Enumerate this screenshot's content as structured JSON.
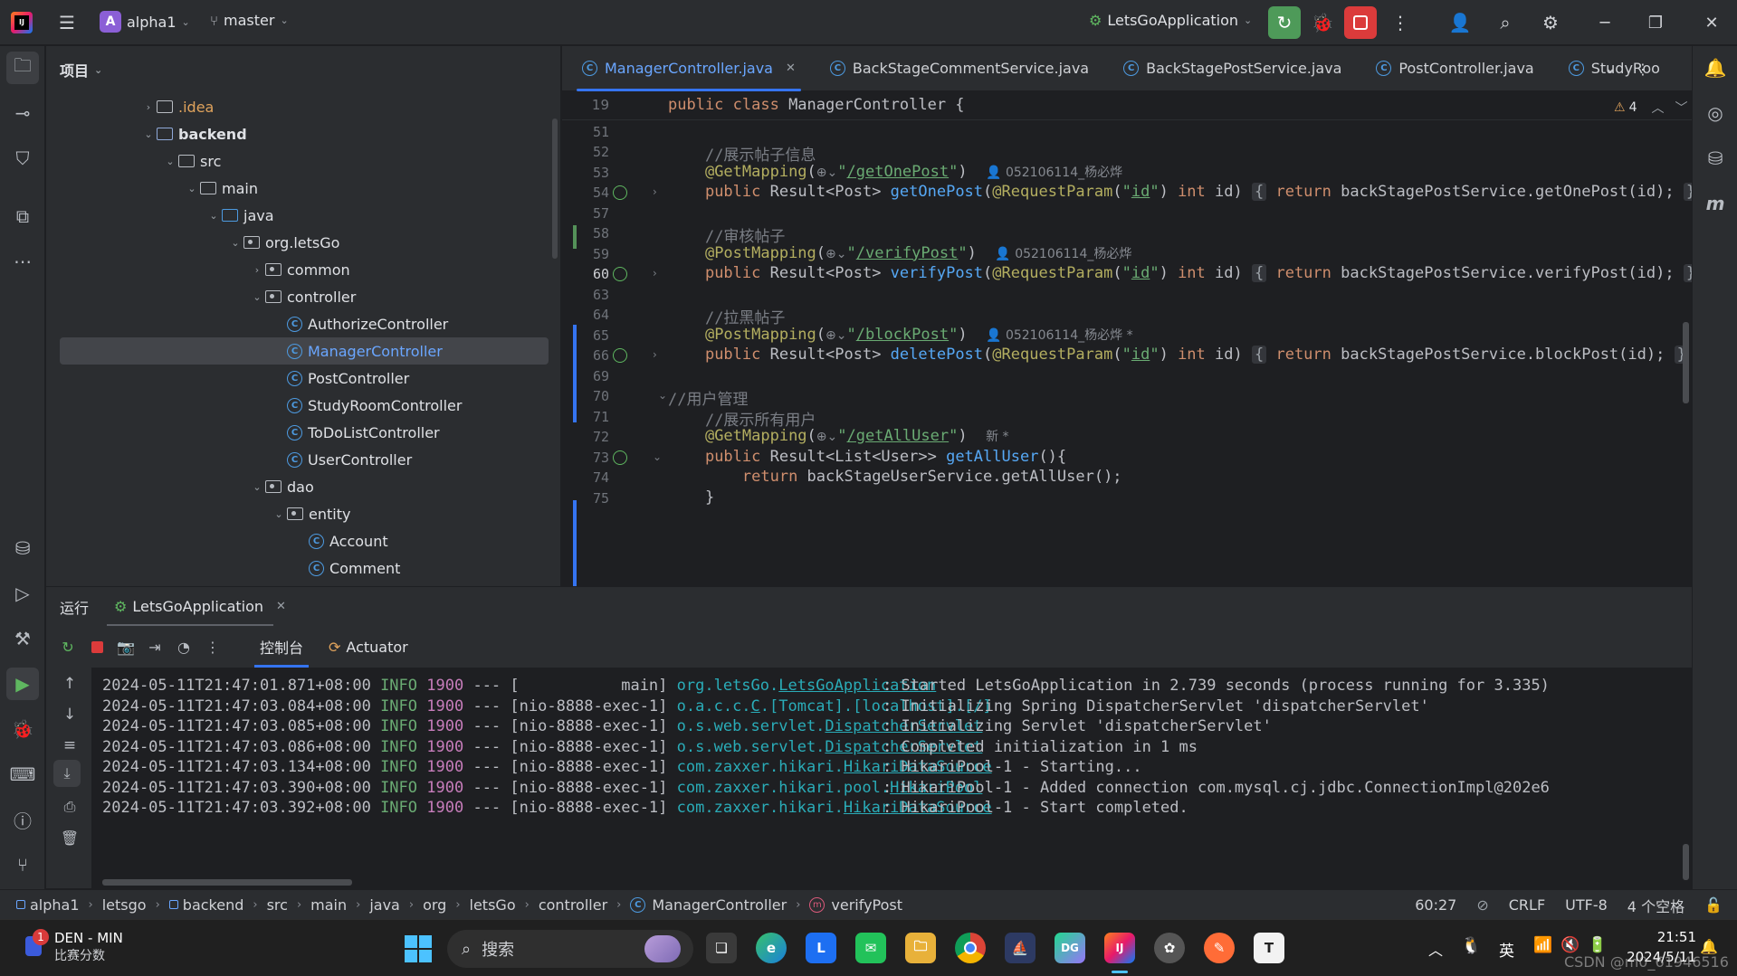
{
  "titlebar": {
    "project_letter": "A",
    "project_name": "alpha1",
    "branch": "master",
    "run_config": "LetsGoApplication"
  },
  "project_panel": {
    "title": "项目",
    "tree": [
      {
        "label": ".idea",
        "kind": "folder",
        "level": 2,
        "arrow": "›",
        "color": "orange"
      },
      {
        "label": "backend",
        "kind": "module",
        "level": 2,
        "arrow": "⌄",
        "bold": true
      },
      {
        "label": "src",
        "kind": "folder",
        "level": 3,
        "arrow": "⌄"
      },
      {
        "label": "main",
        "kind": "folder",
        "level": 4,
        "arrow": "⌄"
      },
      {
        "label": "java",
        "kind": "folder-blue",
        "level": 5,
        "arrow": "⌄"
      },
      {
        "label": "org.letsGo",
        "kind": "package",
        "level": 6,
        "arrow": "⌄"
      },
      {
        "label": "common",
        "kind": "package",
        "level": 7,
        "arrow": "›"
      },
      {
        "label": "controller",
        "kind": "package",
        "level": 7,
        "arrow": "⌄"
      },
      {
        "label": "AuthorizeController",
        "kind": "class",
        "level": 8
      },
      {
        "label": "ManagerController",
        "kind": "class",
        "level": 8,
        "selected": true
      },
      {
        "label": "PostController",
        "kind": "class",
        "level": 8
      },
      {
        "label": "StudyRoomController",
        "kind": "class",
        "level": 8
      },
      {
        "label": "ToDoListController",
        "kind": "class",
        "level": 8
      },
      {
        "label": "UserController",
        "kind": "class",
        "level": 8
      },
      {
        "label": "dao",
        "kind": "package",
        "level": 7,
        "arrow": "⌄"
      },
      {
        "label": "entity",
        "kind": "package",
        "level": 8,
        "arrow": "⌄"
      },
      {
        "label": "Account",
        "kind": "class",
        "level": 9
      },
      {
        "label": "Comment",
        "kind": "class",
        "level": 9
      }
    ]
  },
  "editor": {
    "tabs": [
      {
        "label": "ManagerController.java",
        "active": true
      },
      {
        "label": "BackStageCommentService.java"
      },
      {
        "label": "BackStagePostService.java"
      },
      {
        "label": "PostController.java"
      },
      {
        "label": "StudyRoo"
      }
    ],
    "warning_count": "4",
    "sticky_line_no": "19",
    "sticky_code": "public class ManagerController {",
    "lines": [
      {
        "no": "51",
        "html": ""
      },
      {
        "no": "52",
        "html": "    <span class='cmt'>//展示帖子信息</span>"
      },
      {
        "no": "53",
        "html": "    <span class='ann'>@GetMapping</span>(<span class='hint'>⊕⌄</span><span class='str'>\"<u>/getOnePost</u>\"</span>)  <span class='hint'>👤 052106114_杨必烨</span>"
      },
      {
        "no": "54",
        "html": "    <span class='kw'>public</span> Result&lt;Post&gt; <span class='fn'>getOnePost</span>(<span class='ann'>@RequestParam</span>(<span class='str'>\"<u>id</u>\"</span>) <span class='kw'>int</span> id) <span class='fold'>{</span> <span class='kw'>return</span> backStagePostService.getOnePost(id); <span class='fold'>}</span>",
        "gutter": true
      },
      {
        "no": "57",
        "html": ""
      },
      {
        "no": "58",
        "html": "    <span class='cmt'>//审核帖子</span>"
      },
      {
        "no": "59",
        "html": "    <span class='ann'>@PostMapping</span>(<span class='hint'>⊕⌄</span><span class='str'>\"<u>/verifyPost</u>\"</span>)  <span class='hint'>👤 052106114_杨必烨</span>"
      },
      {
        "no": "60",
        "html": "    <span class='kw'>public</span> Result&lt;Post&gt; <span class='fn'>verifyPost</span>(<span class='ann'>@RequestParam</span>(<span class='str'>\"<u>id</u>\"</span>) <span class='kw'>int</span> id) <span class='fold'>{</span> <span class='kw'>return</span> backStagePostService.verifyPost(id); <span class='fold'>}</span>",
        "gutter": true,
        "current": true
      },
      {
        "no": "63",
        "html": ""
      },
      {
        "no": "64",
        "html": "    <span class='cmt'>//拉黑帖子</span>"
      },
      {
        "no": "65",
        "html": "    <span class='ann'>@PostMapping</span>(<span class='hint'>⊕⌄</span><span class='str'>\"<u>/blockPost</u>\"</span>)  <span class='hint'>👤 052106114_杨必烨 *</span>"
      },
      {
        "no": "66",
        "html": "    <span class='kw'>public</span> Result&lt;Post&gt; <span class='fn'>deletePost</span>(<span class='ann'>@RequestParam</span>(<span class='str'>\"<u>id</u>\"</span>) <span class='kw'>int</span> id) <span class='fold'>{</span> <span class='kw'>return</span> backStagePostService.blockPost(id); <span class='fold'>}</span>",
        "gutter": true
      },
      {
        "no": "69",
        "html": ""
      },
      {
        "no": "70",
        "html": "<span class='cmt'>//用户管理</span>"
      },
      {
        "no": "71",
        "html": "    <span class='cmt'>//展示所有用户</span>"
      },
      {
        "no": "72",
        "html": "    <span class='ann'>@GetMapping</span>(<span class='hint'>⊕⌄</span><span class='str'>\"<u>/getAllUser</u>\"</span>)  <span class='hint'>新 *</span>"
      },
      {
        "no": "73",
        "html": "    <span class='kw'>public</span> Result&lt;List&lt;User&gt;&gt; <span class='fn'>getAllUser</span>(){",
        "gutter": true
      },
      {
        "no": "74",
        "html": "        <span class='kw'>return</span> backStageUserService.getAllUser();"
      },
      {
        "no": "75",
        "html": "    }"
      }
    ]
  },
  "run_panel": {
    "title": "运行",
    "config_tab": "LetsGoApplication",
    "console_tab": "控制台",
    "actuator_tab": "Actuator",
    "logs": [
      {
        "ts": "2024-05-11T21:47:01.871+08:00",
        "level": "INFO",
        "pid": "1900",
        "thread": "[           main]",
        "logger_pre": "org.letsGo.",
        "logger_link": "LetsGoApplication",
        "logger_pad": "           ",
        "msg": ": Started LetsGoApplication in 2.739 seconds (process running for 3.335)"
      },
      {
        "ts": "2024-05-11T21:47:03.084+08:00",
        "level": "INFO",
        "pid": "1900",
        "thread": "[nio-8888-exec-1]",
        "logger_pre": "o.a.c.c.",
        "logger_link": "C",
        "logger_post": ".[Tomcat].[localhost].[/]",
        "logger_pad": "      ",
        "msg": ": Initializing Spring DispatcherServlet 'dispatcherServlet'"
      },
      {
        "ts": "2024-05-11T21:47:03.085+08:00",
        "level": "INFO",
        "pid": "1900",
        "thread": "[nio-8888-exec-1]",
        "logger_pre": "o.s.web.servlet.",
        "logger_link": "DispatcherServlet",
        "logger_pad": "       ",
        "msg": ": Initializing Servlet 'dispatcherServlet'"
      },
      {
        "ts": "2024-05-11T21:47:03.086+08:00",
        "level": "INFO",
        "pid": "1900",
        "thread": "[nio-8888-exec-1]",
        "logger_pre": "o.s.web.servlet.",
        "logger_link": "DispatcherServlet",
        "logger_pad": "       ",
        "msg": ": Completed initialization in 1 ms"
      },
      {
        "ts": "2024-05-11T21:47:03.134+08:00",
        "level": "INFO",
        "pid": "1900",
        "thread": "[nio-8888-exec-1]",
        "logger_pre": "com.zaxxer.hikari.",
        "logger_link": "HikariDataSource",
        "logger_pad": "      ",
        "msg": ": HikariPool-1 - Starting..."
      },
      {
        "ts": "2024-05-11T21:47:03.390+08:00",
        "level": "INFO",
        "pid": "1900",
        "thread": "[nio-8888-exec-1]",
        "logger_pre": "com.zaxxer.hikari.pool.",
        "logger_link": "HikariPool",
        "logger_pad": "       ",
        "msg": ": HikariPool-1 - Added connection com.mysql.cj.jdbc.ConnectionImpl@202e6"
      },
      {
        "ts": "2024-05-11T21:47:03.392+08:00",
        "level": "INFO",
        "pid": "1900",
        "thread": "[nio-8888-exec-1]",
        "logger_pre": "com.zaxxer.hikari.",
        "logger_link": "HikariDataSource",
        "logger_pad": "      ",
        "msg": ": HikariPool-1 - Start completed."
      }
    ]
  },
  "statusbar": {
    "crumbs": [
      "alpha1",
      "letsgo",
      "backend",
      "src",
      "main",
      "java",
      "org",
      "letsGo",
      "controller",
      "ManagerController",
      "verifyPost"
    ],
    "position": "60:27",
    "line_sep": "CRLF",
    "encoding": "UTF-8",
    "indent": "4 个空格"
  },
  "taskbar": {
    "weather_badge": "1",
    "weather_title": "DEN - MIN",
    "weather_sub": "比赛分数",
    "search_placeholder": "搜索",
    "ime": "英",
    "clock_time": "21:51",
    "clock_date": "2024/5/11",
    "watermark": "CSDN @m0_61946516"
  },
  "colors": {
    "accent": "#3574f0",
    "stop_red": "#db3b3b",
    "run_green": "#5fb760"
  }
}
